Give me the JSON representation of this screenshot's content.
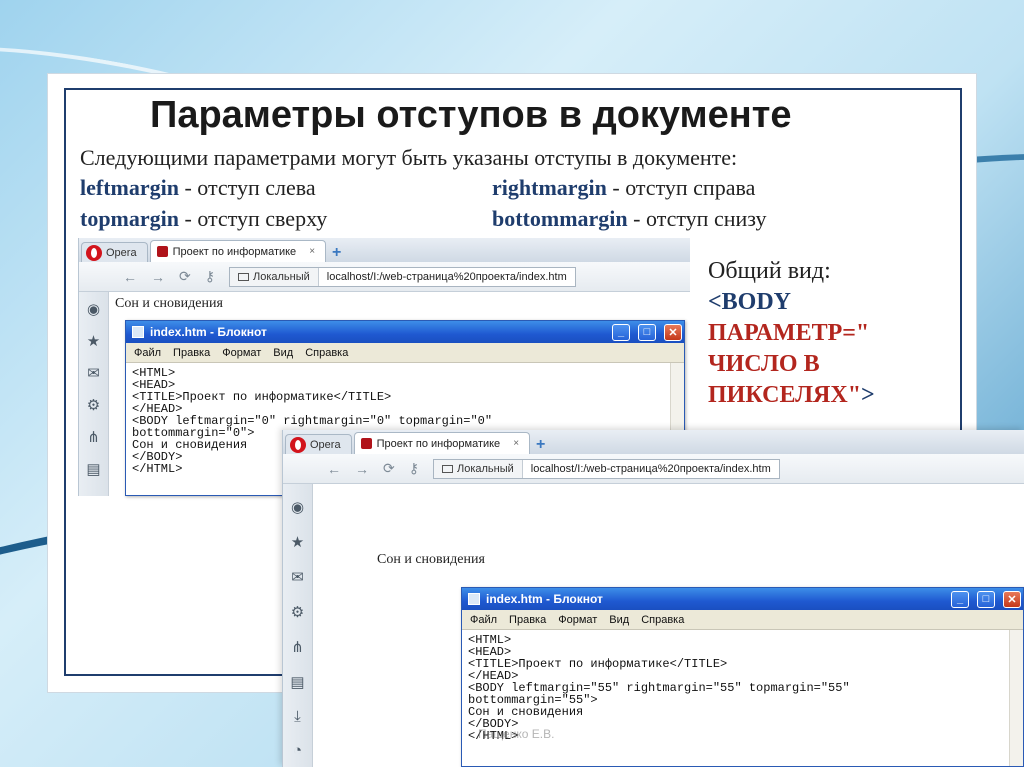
{
  "slide": {
    "title": "Параметры отступов в документе",
    "intro": "Следующими параметрами могут быть указаны отступы в документе:",
    "params": [
      {
        "name": "leftmargin",
        "desc": " - отступ слева"
      },
      {
        "name": "rightmargin",
        "desc": " - отступ справа"
      },
      {
        "name": "topmargin",
        "desc": " - отступ сверху"
      },
      {
        "name": "bottommargin",
        "desc": " - отступ снизу"
      }
    ],
    "general_label": "Общий вид:",
    "general_code_open": "<BODY",
    "general_code_param": "ПАРАМЕТР=\"",
    "general_code_value": "ЧИСЛО В",
    "general_code_unit": "ПИКСЕЛЯХ\"",
    "general_code_close": ">",
    "watermark": "Пащенко Е.В."
  },
  "browser": {
    "opera_label": "Opera",
    "tab_title": "Проект по информатике",
    "tab_close": "×",
    "new_tab": "+",
    "address_local": "Локальный",
    "address_url": "localhost/I:/web-страница%20проекта/index.htm",
    "page_text": "Сон и сновидения"
  },
  "notepad": {
    "title": "index.htm - Блокнот",
    "menu": [
      "Файл",
      "Правка",
      "Формат",
      "Вид",
      "Справка"
    ],
    "code1": "<HTML>\n<HEAD>\n<TITLE>Проект по информатике</TITLE>\n</HEAD>\n<BODY leftmargin=\"0\" rightmargin=\"0\" topmargin=\"0\"\nbottommargin=\"0\">\nСон и сновидения\n</BODY>\n</HTML>",
    "code2": "<HTML>\n<HEAD>\n<TITLE>Проект по информатике</TITLE>\n</HEAD>\n<BODY leftmargin=\"55\" rightmargin=\"55\" topmargin=\"55\"\nbottommargin=\"55\">\nСон и сновидения\n</BODY>\n</HTML>"
  },
  "icons": {
    "back": "←",
    "forward": "→",
    "reload": "⟳",
    "key": "⚷",
    "side": [
      "◉",
      "★",
      "✉",
      "⚙",
      "⋔",
      "▤",
      "⤓",
      "◔"
    ]
  }
}
